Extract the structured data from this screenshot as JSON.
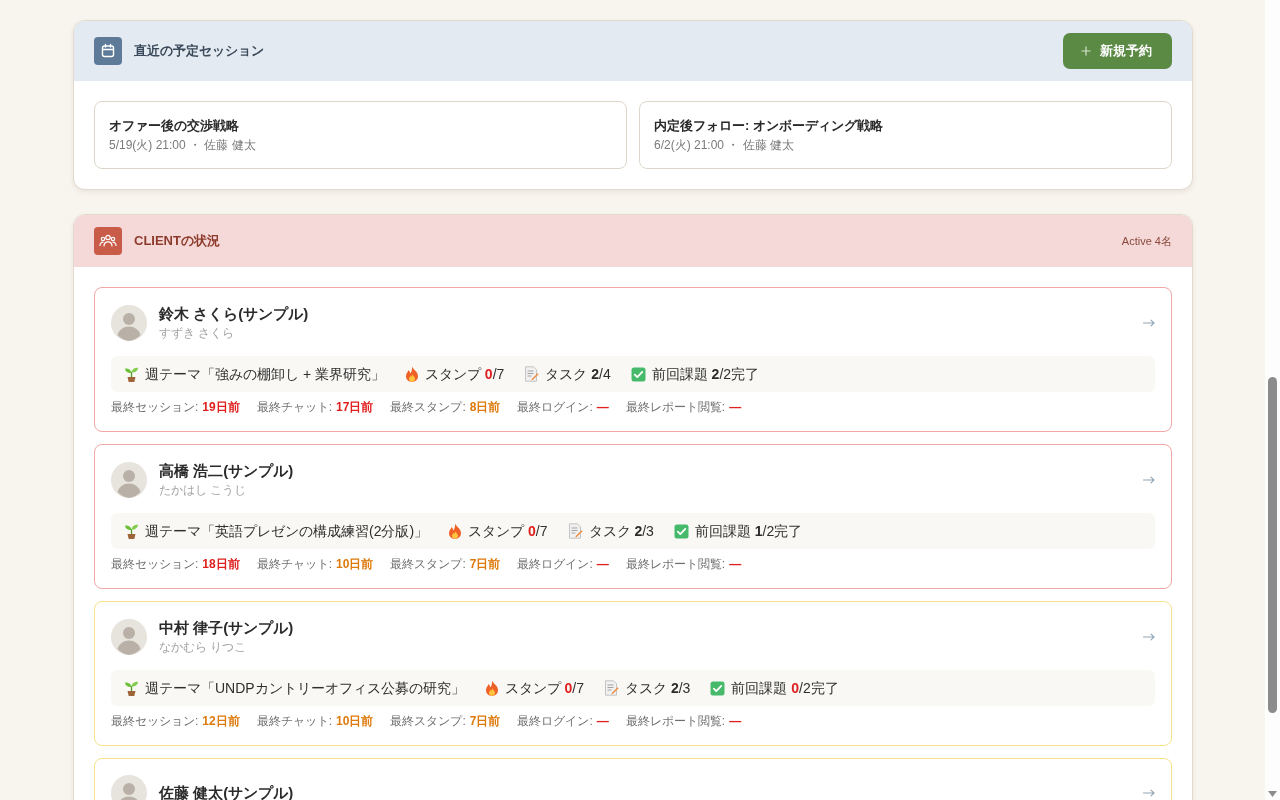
{
  "upcoming": {
    "title": "直近の予定セッション",
    "new_button": "新規予約",
    "sessions": [
      {
        "title": "オファー後の交渉戦略",
        "meta": "5/19(火) 21:00 ・ 佐藤 健太"
      },
      {
        "title": "内定後フォロー: オンボーディング戦略",
        "meta": "6/2(火) 21:00 ・ 佐藤 健太"
      }
    ]
  },
  "clients_panel": {
    "title": "CLIENTの状況",
    "count_label": "Active 4名",
    "clients": [
      {
        "name": "鈴木 さくら(サンプル)",
        "kana": "すずき さくら",
        "color": "#f2a6a6",
        "theme": "週テーマ「強みの棚卸し + 業界研究」",
        "stamp": {
          "label": "スタンプ",
          "count": "0",
          "total": "/7",
          "alert": true
        },
        "task": {
          "label": "タスク",
          "count": "2",
          "total": "/4",
          "alert": false
        },
        "homework": {
          "label": "前回課題",
          "count": "2",
          "total": "/2完了",
          "alert": false
        },
        "activity": [
          {
            "label": "最終セッション:",
            "value": "19日前",
            "color": "#e0201e"
          },
          {
            "label": "最終チャット:",
            "value": "17日前",
            "color": "#e0201e"
          },
          {
            "label": "最終スタンプ:",
            "value": "8日前",
            "color": "#de7a0c"
          },
          {
            "label": "最終ログイン:",
            "value": "—",
            "color": "#e0201e"
          },
          {
            "label": "最終レポート閲覧:",
            "value": "—",
            "color": "#e0201e"
          }
        ]
      },
      {
        "name": "高橋 浩二(サンプル)",
        "kana": "たかはし こうじ",
        "color": "#f2a6a6",
        "theme": "週テーマ「英語プレゼンの構成練習(2分版)」",
        "stamp": {
          "label": "スタンプ",
          "count": "0",
          "total": "/7",
          "alert": true
        },
        "task": {
          "label": "タスク",
          "count": "2",
          "total": "/3",
          "alert": false
        },
        "homework": {
          "label": "前回課題",
          "count": "1",
          "total": "/2完了",
          "alert": false
        },
        "activity": [
          {
            "label": "最終セッション:",
            "value": "18日前",
            "color": "#e0201e"
          },
          {
            "label": "最終チャット:",
            "value": "10日前",
            "color": "#de7a0c"
          },
          {
            "label": "最終スタンプ:",
            "value": "7日前",
            "color": "#de7a0c"
          },
          {
            "label": "最終ログイン:",
            "value": "—",
            "color": "#e0201e"
          },
          {
            "label": "最終レポート閲覧:",
            "value": "—",
            "color": "#e0201e"
          }
        ]
      },
      {
        "name": "中村 律子(サンプル)",
        "kana": "なかむら りつこ",
        "color": "#f7e28e",
        "theme": "週テーマ「UNDPカントリーオフィス公募の研究」",
        "stamp": {
          "label": "スタンプ",
          "count": "0",
          "total": "/7",
          "alert": true
        },
        "task": {
          "label": "タスク",
          "count": "2",
          "total": "/3",
          "alert": false
        },
        "homework": {
          "label": "前回課題",
          "count": "0",
          "total": "/2完了",
          "alert": true
        },
        "activity": [
          {
            "label": "最終セッション:",
            "value": "12日前",
            "color": "#de7a0c"
          },
          {
            "label": "最終チャット:",
            "value": "10日前",
            "color": "#de7a0c"
          },
          {
            "label": "最終スタンプ:",
            "value": "7日前",
            "color": "#de7a0c"
          },
          {
            "label": "最終ログイン:",
            "value": "—",
            "color": "#e0201e"
          },
          {
            "label": "最終レポート閲覧:",
            "value": "—",
            "color": "#e0201e"
          }
        ]
      },
      {
        "name": "佐藤 健太(サンプル)",
        "color": "#f7e28e"
      }
    ]
  }
}
